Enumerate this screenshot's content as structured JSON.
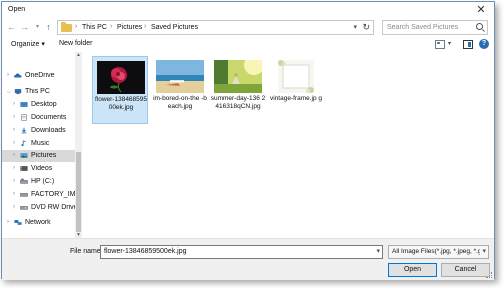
{
  "window": {
    "title": "Open"
  },
  "nav": {
    "back_icon": "back-arrow-icon",
    "forward_icon": "forward-arrow-icon",
    "recent_icon": "chevron-down-icon",
    "up_icon": "up-arrow-icon"
  },
  "address": {
    "segments": [
      "This PC",
      "Pictures",
      "Saved Pictures"
    ]
  },
  "search": {
    "placeholder": "Search Saved Pictures"
  },
  "toolbar": {
    "organize_label": "Organize ▾",
    "new_folder_label": "New folder"
  },
  "sidebar": {
    "items": [
      {
        "label": "OneDrive",
        "icon": "onedrive-icon",
        "color": "#2b6cb0"
      },
      {
        "label": "This PC",
        "icon": "computer-icon",
        "color": "#2b6cb0"
      },
      {
        "label": "Desktop",
        "icon": "desktop-icon",
        "color": "#3b82c4"
      },
      {
        "label": "Documents",
        "icon": "documents-icon",
        "color": "#6b7b8c"
      },
      {
        "label": "Downloads",
        "icon": "downloads-icon",
        "color": "#2b6cb0"
      },
      {
        "label": "Music",
        "icon": "music-icon",
        "color": "#2b6cb0"
      },
      {
        "label": "Pictures",
        "icon": "pictures-icon",
        "color": "#5a9bd5"
      },
      {
        "label": "Videos",
        "icon": "videos-icon",
        "color": "#555555"
      },
      {
        "label": "HP (C:)",
        "icon": "drive-icon",
        "color": "#777777"
      },
      {
        "label": "FACTORY_IMAG",
        "icon": "drive-icon",
        "color": "#777777"
      },
      {
        "label": "DVD RW Drive (E",
        "icon": "dvd-icon",
        "color": "#777777"
      },
      {
        "label": "Network",
        "icon": "network-icon",
        "color": "#2b6cb0"
      }
    ]
  },
  "files": [
    {
      "name": "flower-138468595 00ek.jpg",
      "thumb": "flower-thumbnail"
    },
    {
      "name": "im-bored-on-the -beach.jpg",
      "thumb": "beach-thumbnail"
    },
    {
      "name": "summer-day-136 2416318qCN.jpg",
      "thumb": "summer-thumbnail"
    },
    {
      "name": "vintage-frame.jp g",
      "thumb": "frame-thumbnail"
    }
  ],
  "bottom": {
    "filename_label": "File name:",
    "filename_value": "flower-13846859500ek.jpg",
    "filetype_value": "All Image Files(*.jpg, *.jpeg, *.g",
    "open_label": "Open",
    "cancel_label": "Cancel"
  },
  "colors": {
    "accent": "#0078d7",
    "selection": "#cce4f7",
    "folder": "#e7c051"
  }
}
